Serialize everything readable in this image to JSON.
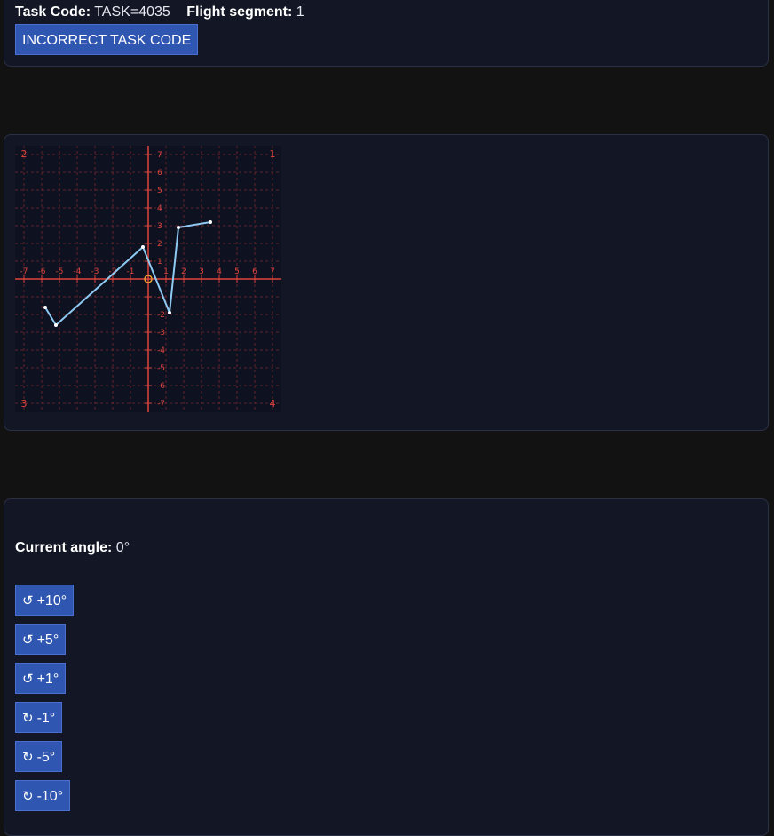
{
  "task": {
    "code_label": "Task Code:",
    "code_value": "TASK=4035",
    "segment_label": "Flight segment:",
    "segment_value": "1",
    "button_label": "INCORRECT TASK CODE"
  },
  "graph": {
    "axis_color": "#e0443c",
    "grid_color": "#7a2a2e",
    "path_color": "#8ec9f2",
    "origin_color": "#f0a030",
    "range": [
      -7.5,
      7.5
    ],
    "x_ticks": [
      "-7",
      "-6",
      "-5",
      "-4",
      "-3",
      "-2",
      "-1",
      "1",
      "2",
      "3",
      "4",
      "5",
      "6",
      "7"
    ],
    "y_ticks": [
      "7",
      "6",
      "5",
      "4",
      "3",
      "2",
      "1",
      "-1",
      "-2",
      "-3",
      "-4",
      "-5",
      "-6",
      "-7"
    ],
    "quadrants": {
      "q1": "1",
      "q2": "2",
      "q3": "3",
      "q4": "4"
    },
    "path_points": [
      {
        "x": -5.8,
        "y": -1.6
      },
      {
        "x": -5.2,
        "y": -2.6
      },
      {
        "x": -0.3,
        "y": 1.8
      },
      {
        "x": 1.2,
        "y": -1.9
      },
      {
        "x": 1.7,
        "y": 2.9
      },
      {
        "x": 3.5,
        "y": 3.2
      }
    ]
  },
  "controls": {
    "angle_label": "Current angle:",
    "angle_value": "0°",
    "buttons": [
      {
        "icon": "↺",
        "label": "+10°"
      },
      {
        "icon": "↺",
        "label": "+5°"
      },
      {
        "icon": "↺",
        "label": "+1°"
      },
      {
        "icon": "↻",
        "label": "-1°"
      },
      {
        "icon": "↻",
        "label": "-5°"
      },
      {
        "icon": "↻",
        "label": "-10°"
      }
    ]
  }
}
